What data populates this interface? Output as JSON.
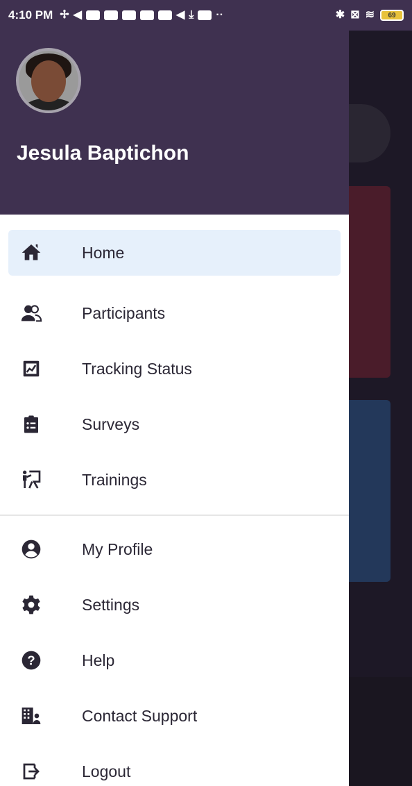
{
  "status_bar": {
    "time": "4:10 PM",
    "battery": "69"
  },
  "drawer": {
    "user_name": "Jesula Baptichon",
    "menu_primary": [
      {
        "label": "Home",
        "icon": "home-icon",
        "active": true
      },
      {
        "label": "Participants",
        "icon": "participants-icon"
      },
      {
        "label": "Tracking Status",
        "icon": "tracking-status-icon"
      },
      {
        "label": "Surveys",
        "icon": "surveys-icon"
      },
      {
        "label": "Trainings",
        "icon": "trainings-icon"
      }
    ],
    "menu_secondary": [
      {
        "label": "My Profile",
        "icon": "profile-icon"
      },
      {
        "label": "Settings",
        "icon": "gear-icon"
      },
      {
        "label": "Help",
        "icon": "help-icon"
      },
      {
        "label": "Contact Support",
        "icon": "contact-support-icon"
      },
      {
        "label": "Logout",
        "icon": "logout-icon"
      }
    ]
  },
  "colors": {
    "header": "#3f3150",
    "active_item": "#e6f0fb",
    "icon": "#2b2735"
  }
}
